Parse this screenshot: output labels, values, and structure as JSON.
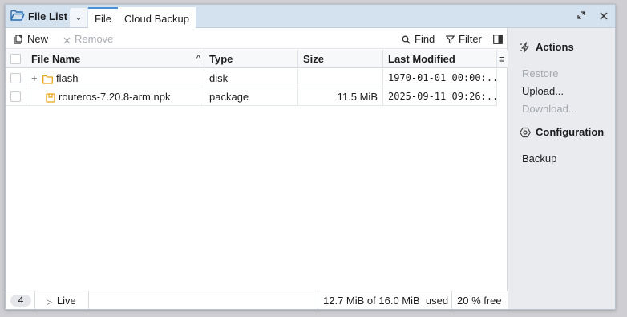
{
  "window": {
    "title": "File List",
    "tabs": [
      {
        "label": "File",
        "active": true
      },
      {
        "label": "Cloud Backup",
        "active": false
      }
    ]
  },
  "toolbar": {
    "new_label": "New",
    "remove_label": "Remove",
    "find_label": "Find",
    "filter_label": "Filter"
  },
  "table": {
    "columns": [
      "File Name",
      "Type",
      "Size",
      "Last Modified"
    ],
    "rows": [
      {
        "name": "flash",
        "type": "disk",
        "size": "",
        "modified": "1970-01-01 00:00:..."
      },
      {
        "name": "routeros-7.20.8-arm.npk",
        "type": "package",
        "size": "11.5 MiB",
        "modified": "2025-09-11 09:26:..."
      }
    ]
  },
  "status": {
    "count": "4",
    "live": "Live",
    "used": "12.7 MiB of 16.0 MiB  used",
    "free": "20 % free"
  },
  "side": {
    "actions_title": "Actions",
    "actions": [
      {
        "label": "Restore",
        "enabled": false
      },
      {
        "label": "Upload...",
        "enabled": true
      },
      {
        "label": "Download...",
        "enabled": false
      }
    ],
    "config_title": "Configuration",
    "config_items": [
      {
        "label": "Backup",
        "enabled": true
      }
    ]
  },
  "colors": {
    "titlebar": "#d4e2f0",
    "accent": "#4a90d9",
    "folder": "#e8a317",
    "side_panel": "#e9ebee",
    "disabled_text": "#a4a8ae"
  },
  "icons": [
    "folder-open-icon",
    "chevron-down-icon",
    "restore-window-icon",
    "close-icon",
    "new-file-icon",
    "remove-icon",
    "search-icon",
    "filter-icon",
    "side-panel-icon",
    "sort-asc-icon",
    "column-menu-icon",
    "folder-icon",
    "package-icon",
    "play-icon",
    "lightning-icon",
    "gear-icon"
  ]
}
